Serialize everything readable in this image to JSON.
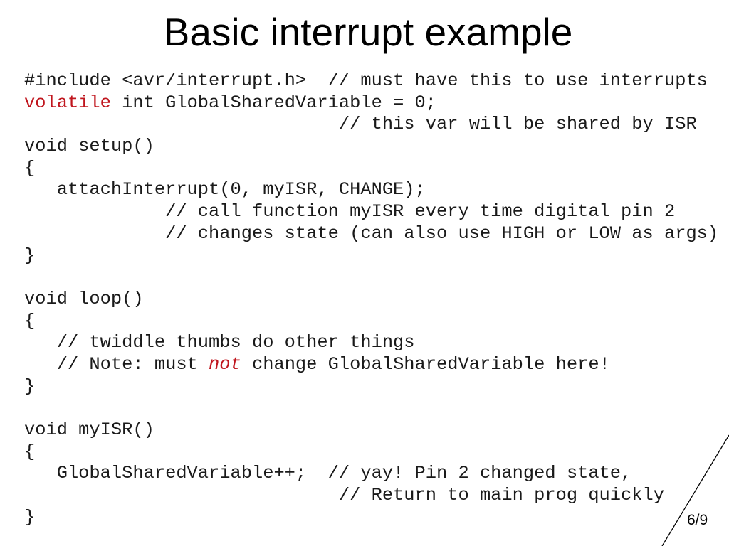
{
  "slide": {
    "title": "Basic interrupt example",
    "page_number": "6/9",
    "accent_color": "#c0161e"
  },
  "code_lines": [
    [
      {
        "t": "#include <avr/interrupt.h>  // must have this to use interrupts"
      }
    ],
    [
      {
        "t": "volatile",
        "style": "red"
      },
      {
        "t": " int GlobalSharedVariable = 0;"
      }
    ],
    [
      {
        "t": "                             // this var will be shared by ISR"
      }
    ],
    [
      {
        "t": "void setup()"
      }
    ],
    [
      {
        "t": "{"
      }
    ],
    [
      {
        "t": "   attachInterrupt(0, myISR, CHANGE);"
      }
    ],
    [
      {
        "t": "             // call function myISR every time digital pin 2"
      }
    ],
    [
      {
        "t": "             // changes state (can also use HIGH or LOW as args)"
      }
    ],
    [
      {
        "t": "}"
      }
    ],
    [
      {
        "t": ""
      }
    ],
    [
      {
        "t": "void loop()"
      }
    ],
    [
      {
        "t": "{"
      }
    ],
    [
      {
        "t": "   // twiddle thumbs do other things"
      }
    ],
    [
      {
        "t": "   // Note: must "
      },
      {
        "t": "not",
        "style": "red ital"
      },
      {
        "t": " change GlobalSharedVariable here!"
      }
    ],
    [
      {
        "t": "}"
      }
    ],
    [
      {
        "t": ""
      }
    ],
    [
      {
        "t": "void myISR()"
      }
    ],
    [
      {
        "t": "{"
      }
    ],
    [
      {
        "t": "   GlobalSharedVariable++;  // yay! Pin 2 changed state,"
      }
    ],
    [
      {
        "t": "                             // Return to main prog quickly"
      }
    ],
    [
      {
        "t": "}"
      }
    ]
  ]
}
